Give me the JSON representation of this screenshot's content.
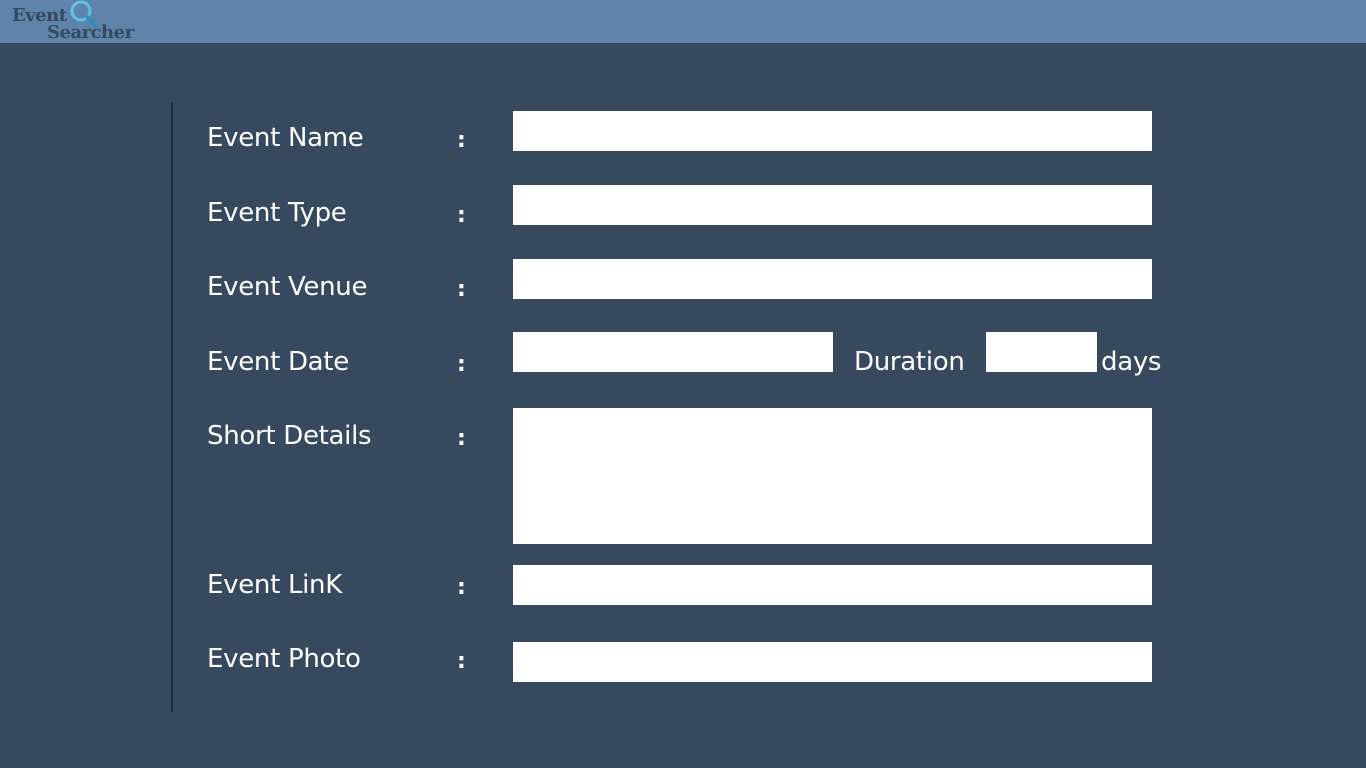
{
  "app": {
    "logo_word1": "Event",
    "logo_word2": "Searcher",
    "brand_color": "#5f84ac",
    "background_color": "#36495f"
  },
  "form": {
    "separator": ":",
    "event_name": {
      "label": "Event Name",
      "value": ""
    },
    "event_type": {
      "label": "Event Type",
      "value": ""
    },
    "event_venue": {
      "label": "Event Venue",
      "value": ""
    },
    "event_date": {
      "label": "Event Date",
      "value": ""
    },
    "duration": {
      "label": "Duration",
      "value": "",
      "unit": "days"
    },
    "short_details": {
      "label": "Short Details",
      "value": ""
    },
    "event_link": {
      "label": "Event LinK",
      "value": ""
    },
    "event_photo": {
      "label": "Event Photo",
      "value": ""
    }
  },
  "icons": {
    "logo_magnifier": "search-icon"
  }
}
